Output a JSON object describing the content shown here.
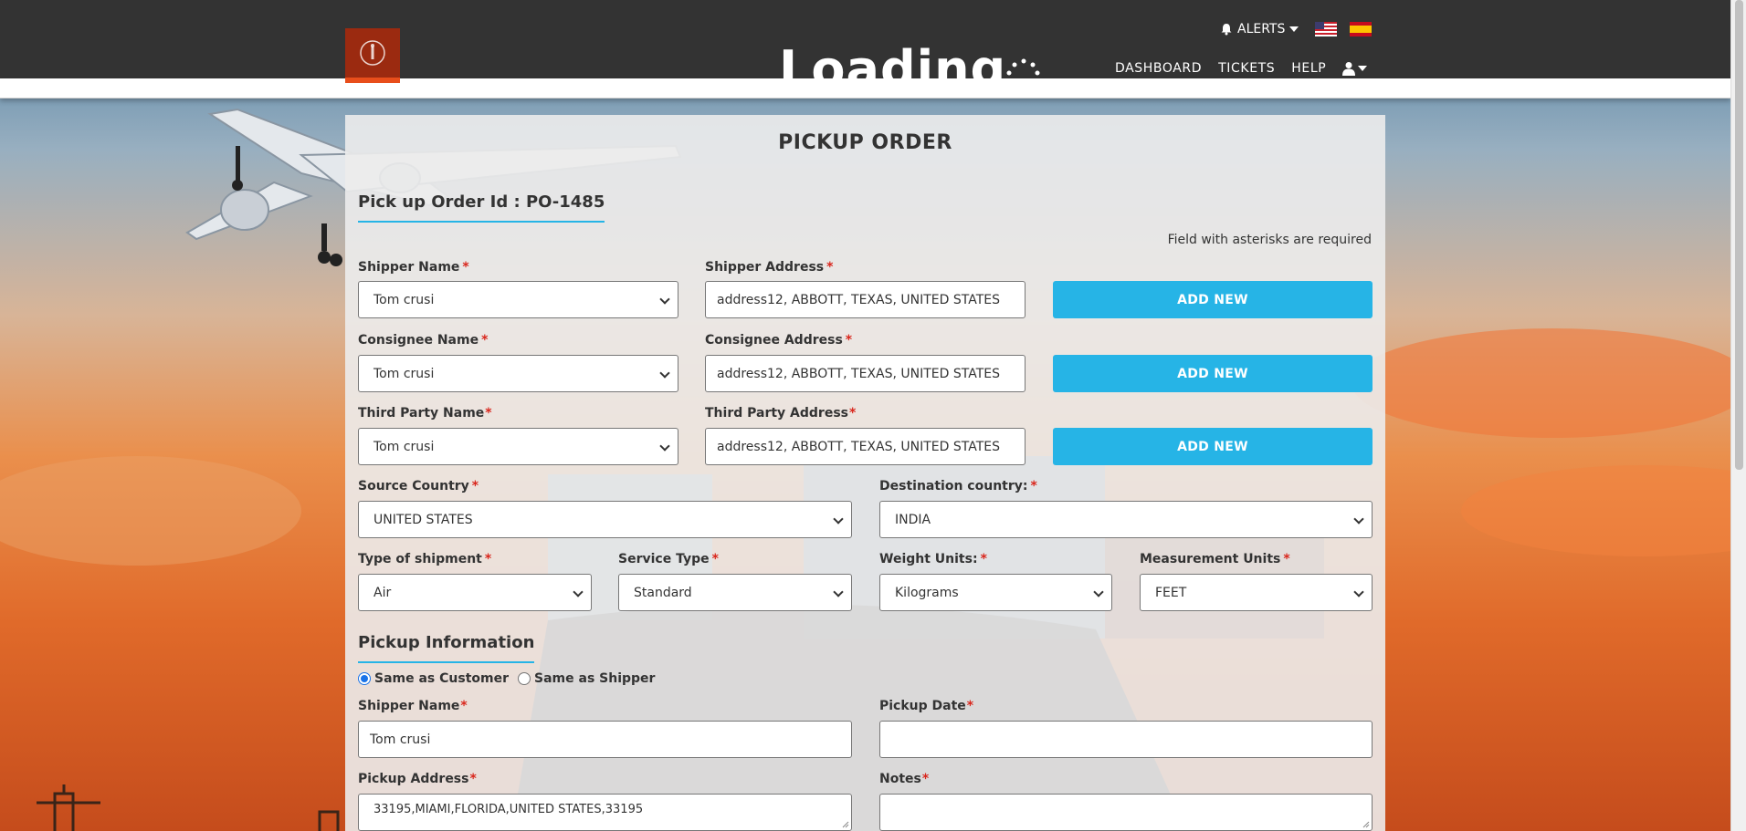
{
  "header": {
    "loading_text": "Loading",
    "alerts_label": "ALERTS",
    "nav": {
      "dashboard": "DASHBOARD",
      "tickets": "TICKETS",
      "help": "HELP"
    }
  },
  "page": {
    "title": "PICKUP ORDER",
    "order_id": "Pick up Order Id : PO-1485",
    "required_note": "Field with asterisks are required"
  },
  "form": {
    "asterisk": "*",
    "shipper_name": {
      "label": "Shipper Name",
      "value": "Tom crusi"
    },
    "shipper_address": {
      "label": "Shipper Address",
      "value": "address12, ABBOTT, TEXAS, UNITED STATES"
    },
    "consignee_name": {
      "label": "Consignee Name",
      "value": "Tom crusi"
    },
    "consignee_address": {
      "label": "Consignee Address",
      "value": "address12, ABBOTT, TEXAS, UNITED STATES"
    },
    "third_party_name": {
      "label": "Third Party Name",
      "value": "Tom crusi"
    },
    "third_party_address": {
      "label": "Third Party Address",
      "value": "address12, ABBOTT, TEXAS, UNITED STATES"
    },
    "add_new_label": "ADD NEW",
    "source_country": {
      "label": "Source Country",
      "value": "UNITED STATES"
    },
    "destination_country": {
      "label": "Destination country:",
      "value": "INDIA"
    },
    "shipment_type": {
      "label": "Type of shipment",
      "value": "Air"
    },
    "service_type": {
      "label": "Service Type",
      "value": "Standard"
    },
    "weight_units": {
      "label": "Weight Units:",
      "value": "Kilograms"
    },
    "measurement_units": {
      "label": "Measurement Units",
      "value": "FEET"
    }
  },
  "pickup": {
    "section_title": "Pickup Information",
    "radio_same_customer": "Same as Customer",
    "radio_same_shipper": "Same as Shipper",
    "selected_option": "Same as Customer",
    "shipper_name": {
      "label": "Shipper Name",
      "value": "Tom crusi"
    },
    "pickup_date": {
      "label": "Pickup Date",
      "value": ""
    },
    "pickup_address": {
      "label": "Pickup Address",
      "value": "33195,MIAMI,FLORIDA,UNITED STATES,33195"
    },
    "notes": {
      "label": "Notes",
      "value": ""
    }
  },
  "colors": {
    "navbar": "#333333",
    "accent": "#26b4e6",
    "logo": "#9b2a10",
    "required": "#d9261c"
  },
  "icons": [
    "bell-icon",
    "caret-down-icon",
    "us-flag-icon",
    "spain-flag-icon",
    "user-icon",
    "logo-icon",
    "spinner-icon"
  ]
}
